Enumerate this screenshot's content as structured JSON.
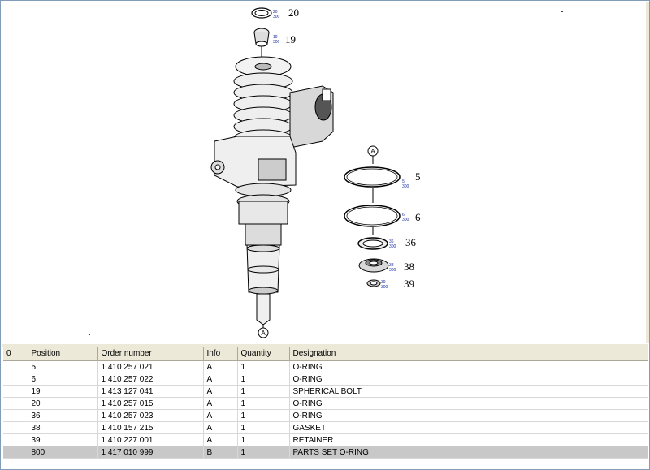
{
  "drawing": {
    "callouts": [
      "20",
      "19",
      "5",
      "6",
      "36",
      "38",
      "39"
    ],
    "callout_codes": [
      "20",
      "300",
      "19",
      "300",
      "5",
      "300",
      "6",
      "300",
      "36",
      "300",
      "38",
      "300",
      "39",
      "300"
    ],
    "markers": [
      "A",
      "A"
    ]
  },
  "table": {
    "headers": [
      "0",
      "Position",
      "Order number",
      "Info",
      "Quantity",
      "Designation"
    ],
    "rows": [
      {
        "position": "5",
        "order": "1 410 257 021",
        "info": "A",
        "qty": "1",
        "designation": "O-RING"
      },
      {
        "position": "6",
        "order": "1 410 257 022",
        "info": "A",
        "qty": "1",
        "designation": "O-RING"
      },
      {
        "position": "19",
        "order": "1 413 127 041",
        "info": "A",
        "qty": "1",
        "designation": "SPHERICAL BOLT"
      },
      {
        "position": "20",
        "order": "1 410 257 015",
        "info": "A",
        "qty": "1",
        "designation": "O-RING"
      },
      {
        "position": "36",
        "order": "1 410 257 023",
        "info": "A",
        "qty": "1",
        "designation": "O-RING"
      },
      {
        "position": "38",
        "order": "1 410 157 215",
        "info": "A",
        "qty": "1",
        "designation": "GASKET"
      },
      {
        "position": "39",
        "order": "1 410 227 001",
        "info": "A",
        "qty": "1",
        "designation": "RETAINER"
      },
      {
        "position": "800",
        "order": "1 417 010 999",
        "info": "B",
        "qty": "1",
        "designation": "PARTS SET O-RING"
      }
    ],
    "selected_index": 7
  },
  "colors": {
    "selected_row": "#c8c8c8",
    "header_bg": "#ece9d8",
    "code_text": "#1a2fa0"
  }
}
